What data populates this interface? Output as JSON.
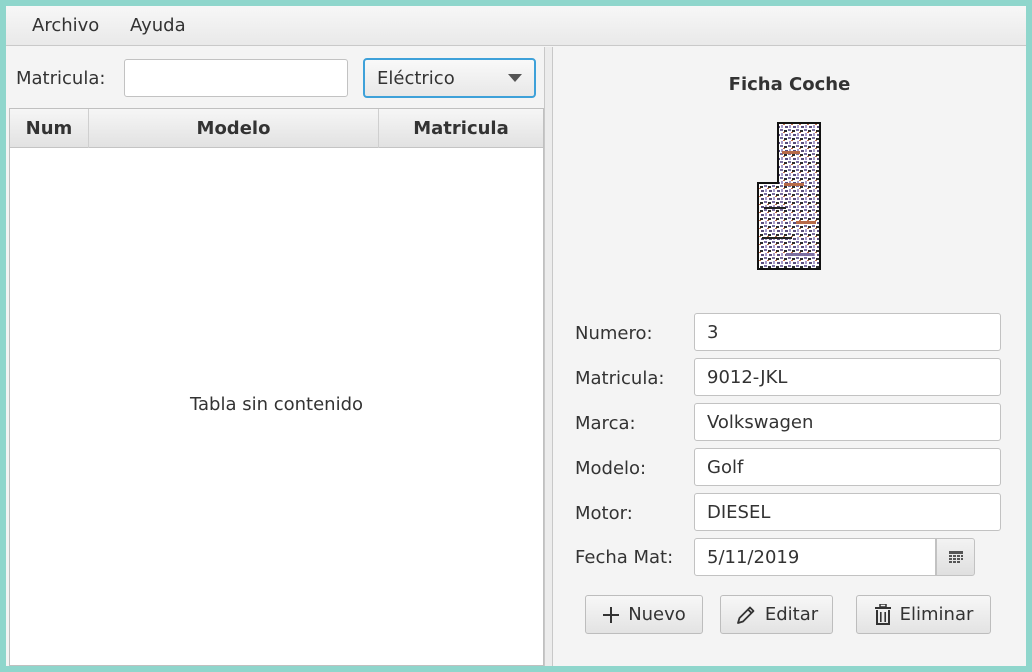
{
  "menubar": {
    "items": [
      {
        "label": "Archivo"
      },
      {
        "label": "Ayuda"
      }
    ]
  },
  "filter": {
    "label": "Matricula:",
    "value": "",
    "motor_selected": "Eléctrico"
  },
  "table": {
    "columns": [
      "Num",
      "Modelo",
      "Matricula"
    ],
    "rows": [],
    "empty_message": "Tabla sin contenido"
  },
  "ficha": {
    "title": "Ficha Coche",
    "fields": {
      "numero": {
        "label": "Numero:",
        "value": "3"
      },
      "matricula": {
        "label": "Matricula:",
        "value": "9012-JKL"
      },
      "marca": {
        "label": "Marca:",
        "value": "Volkswagen"
      },
      "modelo": {
        "label": "Modelo:",
        "value": "Golf"
      },
      "motor": {
        "label": "Motor:",
        "value": "DIESEL"
      },
      "fecha": {
        "label": "Fecha Mat:",
        "value": "5/11/2019"
      }
    },
    "buttons": {
      "nuevo": "Nuevo",
      "editar": "Editar",
      "eliminar": "Eliminar"
    }
  },
  "icons": {
    "nuevo": "plus-icon",
    "editar": "pencil-icon",
    "eliminar": "trash-icon",
    "fecha": "calendar-icon",
    "combo": "chevron-down-icon"
  },
  "colors": {
    "focus_border": "#3ea1d9",
    "background_frame": "#8fd6cc"
  }
}
